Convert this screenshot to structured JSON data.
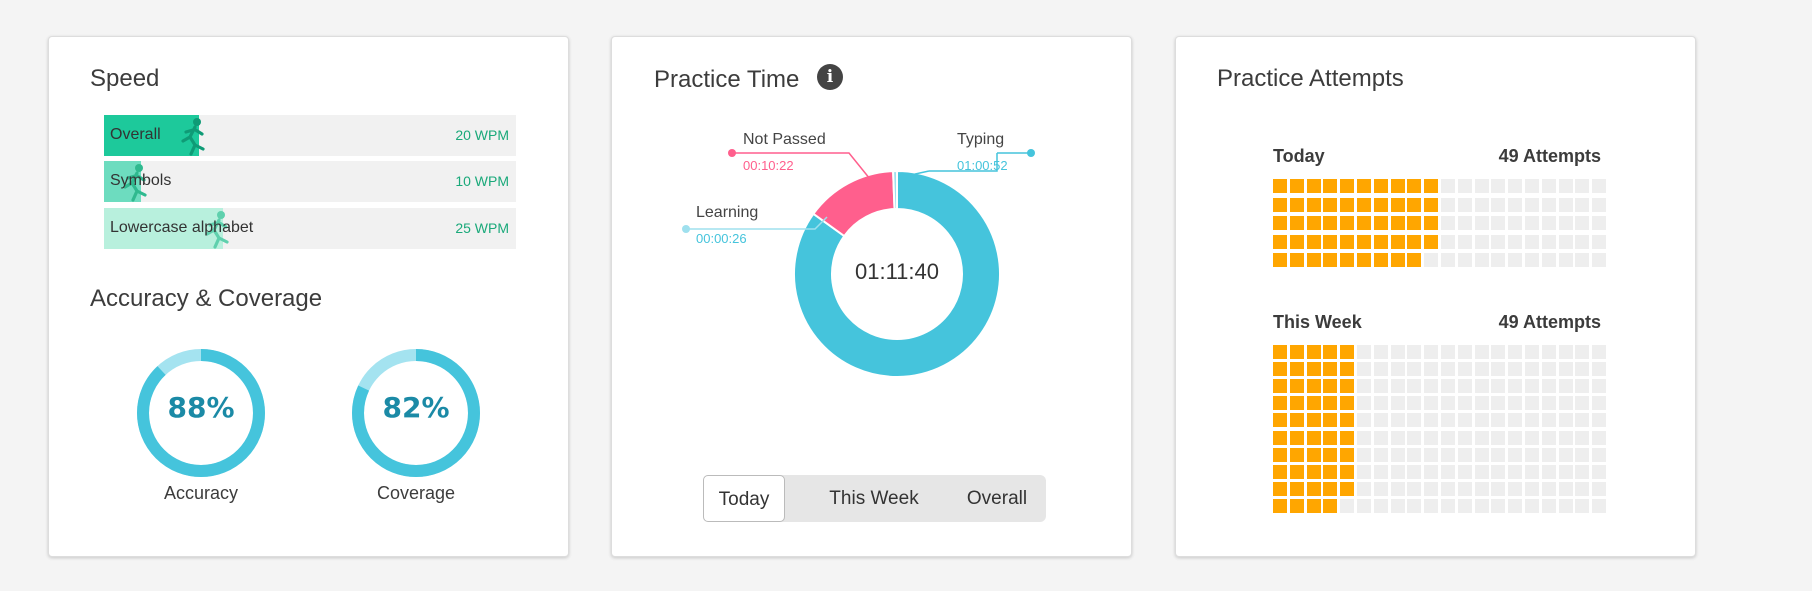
{
  "speed": {
    "title": "Speed",
    "items": [
      {
        "label": "Overall",
        "value": "20 WPM",
        "fill": 0.23,
        "color": "#1dc99b"
      },
      {
        "label": "Symbols",
        "value": "10 WPM",
        "fill": 0.09,
        "color": "#6ddcbf"
      },
      {
        "label": "Lowercase alphabet",
        "value": "25 WPM",
        "fill": 0.29,
        "color": "#b8f0dd"
      }
    ]
  },
  "accuracy": {
    "title": "Accuracy & Coverage",
    "gauges": [
      {
        "label": "Accuracy",
        "value_text": "88%",
        "value": 0.88
      },
      {
        "label": "Coverage",
        "value_text": "82%",
        "value": 0.82
      }
    ],
    "colors": {
      "main": "#45c4dc",
      "track": "#a4e3f0"
    }
  },
  "practice_time": {
    "title": "Practice Time",
    "info_icon": "info-icon",
    "total": "01:11:40",
    "segments": [
      {
        "name": "Typing",
        "time": "01:00:52",
        "seconds": 3652,
        "color": "#45c4dc"
      },
      {
        "name": "Not Passed",
        "time": "00:10:22",
        "seconds": 622,
        "color": "#ff5f8d"
      },
      {
        "name": "Learning",
        "time": "00:00:26",
        "seconds": 26,
        "color": "#9fe0ee"
      }
    ],
    "tabs": [
      {
        "label": "Today",
        "active": true
      },
      {
        "label": "This Week",
        "active": false
      },
      {
        "label": "Overall",
        "active": false
      }
    ]
  },
  "attempts": {
    "title": "Practice Attempts",
    "colors": {
      "filled": "#ffa600",
      "empty": "#eeeeee"
    },
    "today": {
      "label": "Today",
      "count_text": "49 Attempts",
      "filled": 49,
      "capacity": 100
    },
    "week": {
      "label": "This Week",
      "count_text": "49 Attempts",
      "filled": 49,
      "capacity": 200
    }
  }
}
